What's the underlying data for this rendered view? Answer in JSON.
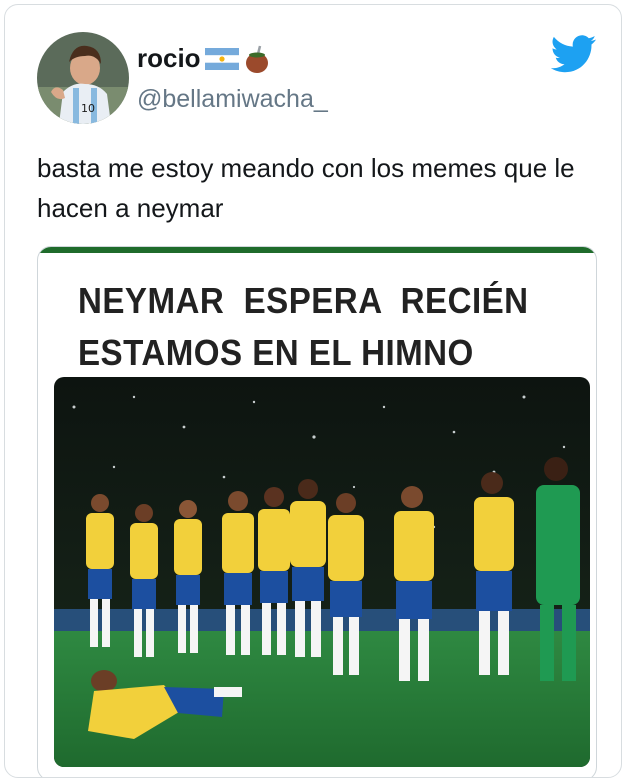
{
  "user": {
    "display_name": "rocio",
    "handle": "@bellamiwacha_",
    "emoji_flag_icon": "argentina-flag-icon",
    "emoji_mate_icon": "mate-cup-icon"
  },
  "tweet": {
    "text": "basta me estoy meando con los memes que le hacen a neymar"
  },
  "meme": {
    "caption_line1": "NEYMAR  ESPERA  RECIÉN",
    "caption_line2": "ESTAMOS EN EL HIMNO"
  },
  "colors": {
    "twitter_blue": "#1da1f2",
    "handle_gray": "#657786",
    "text_black": "#14171a",
    "brazil_yellow": "#f2d03b",
    "brazil_blue": "#1c4fa0",
    "goalkeeper_green": "#1f9a52",
    "pitch_green": "#2f7d3a"
  }
}
